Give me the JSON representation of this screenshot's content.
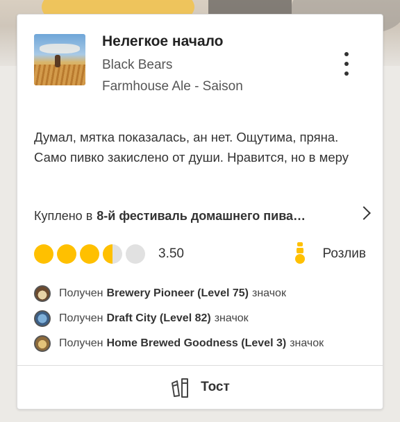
{
  "checkin": {
    "beer_name": "Нелегкое начало",
    "brewery": "Black Bears",
    "style": "Farmhouse Ale - Saison",
    "review": "Думал, мятка показалась, ан нет. Ощутима, пряна. Само пивко закислено от души. Нравится, но в меру",
    "venue_prefix": "Куплено в",
    "venue_name": "8-й фестиваль домашнего пива…",
    "rating": 3.5,
    "rating_text": "3.50",
    "serving": "Розлив",
    "icons": {
      "thumbnail": "beer-label-thumbnail",
      "menu": "kebab-menu-icon",
      "venue": "chevron-right-icon",
      "serving": "tap-icon",
      "toast": "toast-glasses-icon"
    }
  },
  "badges": [
    {
      "prefix": "Получен",
      "name": "Brewery Pioneer (Level 75)",
      "suffix": "значок"
    },
    {
      "prefix": "Получен",
      "name": "Draft City (Level 82)",
      "suffix": "значок"
    },
    {
      "prefix": "Получен",
      "name": "Home Brewed Goodness (Level 3)",
      "suffix": "значок"
    }
  ],
  "actions": {
    "toast_label": "Тост"
  },
  "colors": {
    "accent": "#ffc000",
    "cap_empty": "#e1e1e1",
    "text": "#333333"
  }
}
